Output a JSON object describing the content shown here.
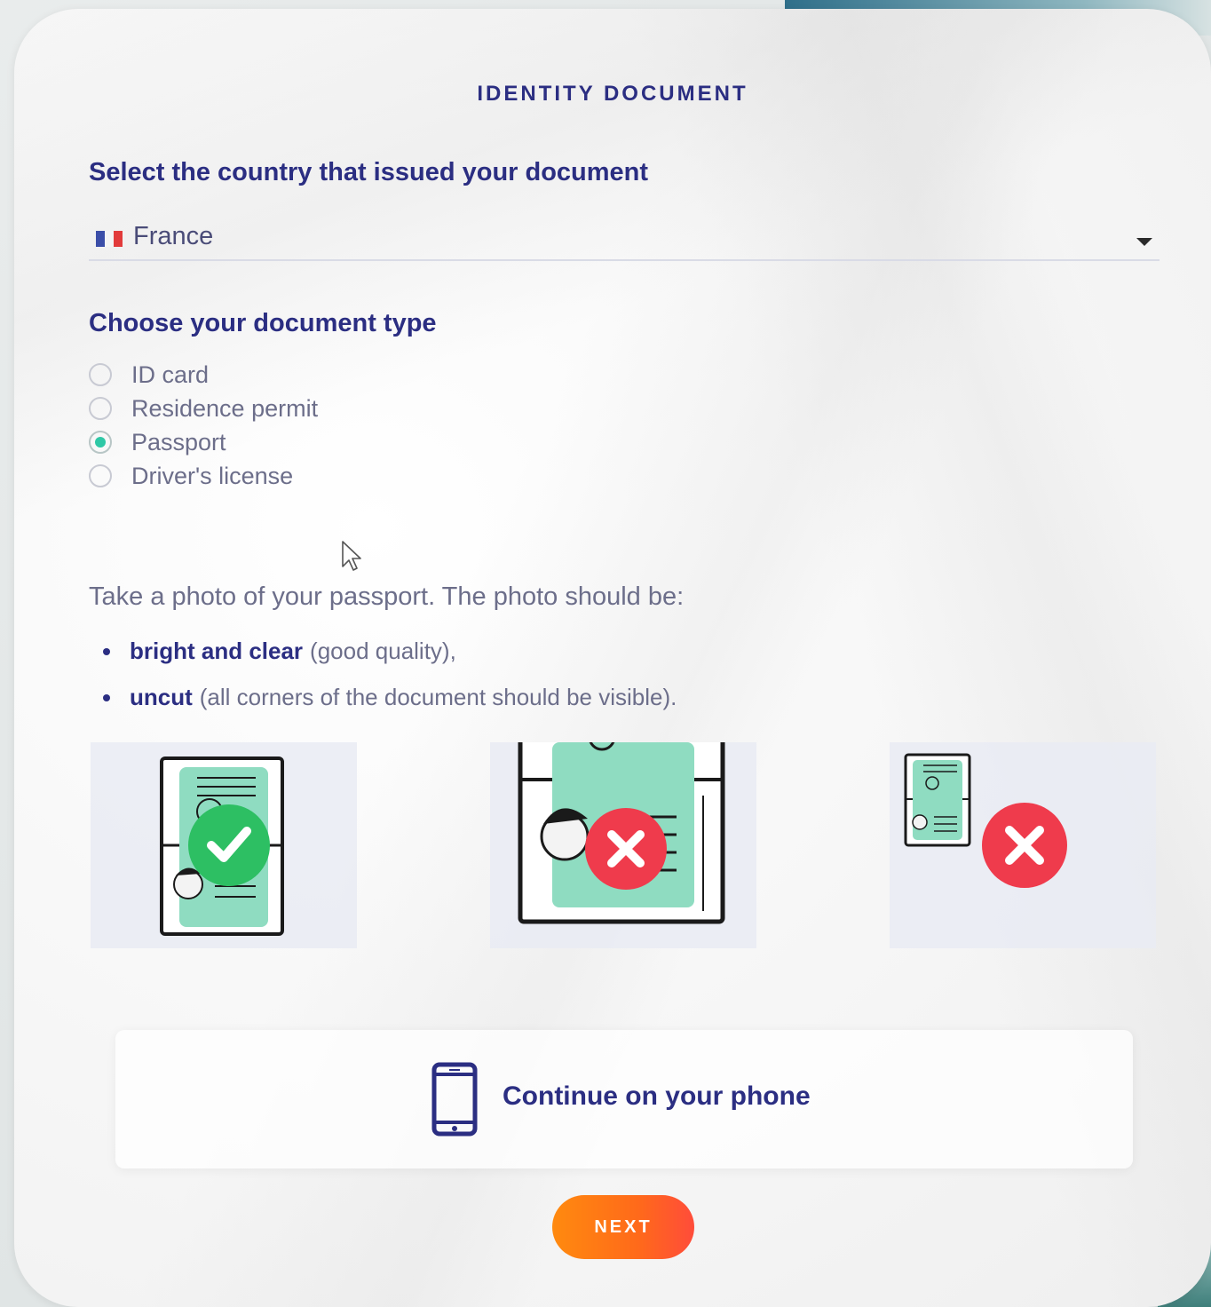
{
  "header": {
    "title": "IDENTITY DOCUMENT"
  },
  "country": {
    "label": "Select the country that issued your document",
    "selected": "France",
    "flag_colors": [
      "#3b4ea8",
      "#f4f4f4",
      "#e23b3b"
    ]
  },
  "document_type": {
    "label": "Choose your document type",
    "options": [
      {
        "label": "ID card",
        "checked": false
      },
      {
        "label": "Residence permit",
        "checked": false
      },
      {
        "label": "Passport",
        "checked": true
      },
      {
        "label": "Driver's license",
        "checked": false
      }
    ]
  },
  "instructions": {
    "intro": "Take a photo of your passport. The photo should be:",
    "bullets": [
      {
        "bold": "bright and clear",
        "rest": "(good quality),"
      },
      {
        "bold": "uncut",
        "rest": "(all corners of the document should be visible)."
      }
    ]
  },
  "examples": [
    {
      "status": "correct",
      "icon": "check-icon"
    },
    {
      "status": "incorrect",
      "icon": "close-icon"
    },
    {
      "status": "incorrect",
      "icon": "close-icon"
    }
  ],
  "phone_option": {
    "label": "Continue on your phone",
    "icon": "phone-icon"
  },
  "actions": {
    "next_label": "NEXT"
  },
  "colors": {
    "primary": "#2b2e82",
    "accent_green": "#2fc8a6",
    "ok": "#2dbf63",
    "error": "#ef3b4c",
    "next_start": "#ff8a0f",
    "next_end": "#ff4c3a"
  }
}
